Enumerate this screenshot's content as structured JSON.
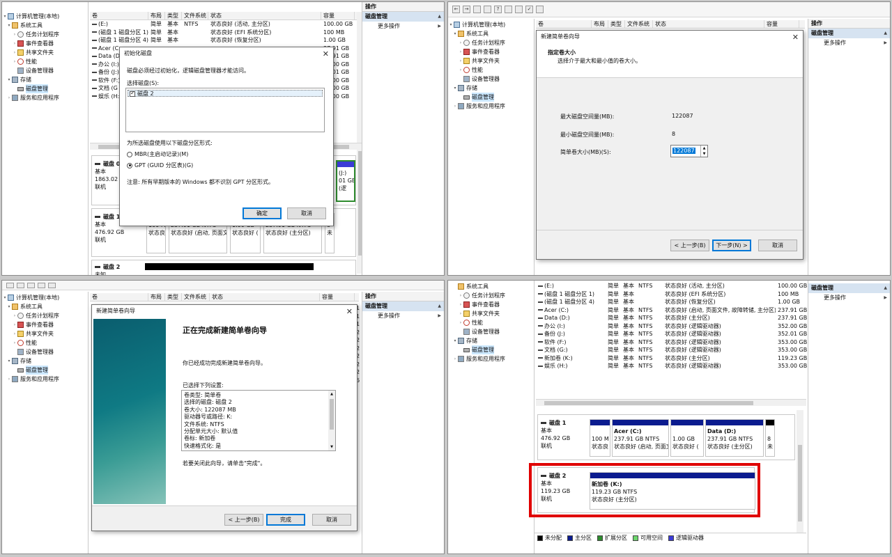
{
  "tree": {
    "root": "计算机管理(本地)",
    "system_tools": "系统工具",
    "task_scheduler": "任务计划程序",
    "event_viewer": "事件查看器",
    "shared_folders": "共享文件夹",
    "performance": "性能",
    "device_manager": "设备管理器",
    "storage": "存储",
    "disk_management": "磁盘管理",
    "services": "服务和应用程序"
  },
  "columns": {
    "volume": "卷",
    "layout": "布局",
    "type": "类型",
    "fs": "文件系统",
    "status": "状态",
    "capacity": "容量"
  },
  "actions": {
    "header": "操作",
    "section": "磁盘管理",
    "more": "更多操作"
  },
  "p1": {
    "volumes": [
      {
        "name": "(E:)",
        "layout": "简单",
        "type": "基本",
        "fs": "NTFS",
        "status": "状态良好 (活动, 主分区)",
        "cap": "100.00 GB",
        "x": "1"
      },
      {
        "name": "(磁盘 1 磁盘分区 1)",
        "layout": "简单",
        "type": "基本",
        "fs": "",
        "status": "状态良好 (EFI 系统分区)",
        "cap": "100 MB",
        "x": "1"
      },
      {
        "name": "(磁盘 1 磁盘分区 4)",
        "layout": "简单",
        "type": "基本",
        "fs": "",
        "status": "状态良好 (恢复分区)",
        "cap": "1.00 GB",
        "x": "1"
      },
      {
        "name": "Acer (C",
        "layout": "",
        "type": "",
        "fs": "",
        "status": "",
        "cap": "37.91 GB",
        "x": "2"
      },
      {
        "name": "Data (D",
        "layout": "",
        "type": "",
        "fs": "",
        "status": "",
        "cap": "37.91 GB",
        "x": "2"
      },
      {
        "name": "办公 (I:)",
        "layout": "",
        "type": "",
        "fs": "",
        "status": "",
        "cap": "52.00 GB",
        "x": "2"
      },
      {
        "name": "备份 (J:)",
        "layout": "",
        "type": "",
        "fs": "",
        "status": "",
        "cap": "52.01 GB",
        "x": "2"
      },
      {
        "name": "软件 (F:)",
        "layout": "",
        "type": "",
        "fs": "",
        "status": "",
        "cap": "53.00 GB",
        "x": "2"
      },
      {
        "name": "文档 (G",
        "layout": "",
        "type": "",
        "fs": "",
        "status": "",
        "cap": "53.00 GB",
        "x": "2"
      },
      {
        "name": "娱乐 (H:",
        "layout": "",
        "type": "",
        "fs": "",
        "status": "",
        "cap": "53.00 GB",
        "x": "6"
      }
    ],
    "disk0": {
      "name": "磁盘 0",
      "kind": "基本",
      "size": "1863.02 G",
      "state": "联机",
      "tail1": "(J:)",
      "tail2": "01 GB",
      "tail3": "(逻"
    },
    "disk1": {
      "name": "磁盘 1",
      "kind": "基本",
      "size": "476.92 GB",
      "state": "联机",
      "parts": [
        {
          "l1": "100 M",
          "l2": "状态良"
        },
        {
          "l1": "237.91 GB NTFS",
          "l2": "状态良好 (启动, 页面文"
        },
        {
          "l1": "1.00 GB",
          "l2": "状态良好 ("
        },
        {
          "l1": "237.91 GB NTFS",
          "l2": "状态良好 (主分区)"
        },
        {
          "l1": "8",
          "l2": "未"
        }
      ]
    },
    "disk2": {
      "name": "磁盘 2",
      "kind": "未知"
    },
    "dialog": {
      "title": "初始化磁盘",
      "intro": "磁盘必须经过初始化，逻辑磁盘管理器才能访问。",
      "select_label": "选择磁盘(S):",
      "disk_item": "磁盘 2",
      "style_label": "为所选磁盘使用以下磁盘分区形式:",
      "mbr": "MBR(主启动记录)(M)",
      "gpt": "GPT (GUID 分区表)(G)",
      "note": "注意: 所有早期版本的 Windows 都不识别 GPT 分区形式。",
      "ok": "确定",
      "cancel": "取消"
    }
  },
  "p2": {
    "dialog": {
      "title": "新建简单卷向导",
      "heading": "指定卷大小",
      "subheading": "选择介于最大和最小值的卷大小。",
      "max_label": "最大磁盘空间量(MB):",
      "max_value": "122087",
      "min_label": "最小磁盘空间量(MB):",
      "min_value": "8",
      "size_label": "简单卷大小(MB)(S):",
      "size_value": "122087",
      "back": "< 上一步(B)",
      "next": "下一步(N) >",
      "cancel": "取消"
    },
    "right_digits": [
      "5",
      "1",
      "1",
      "2",
      "2",
      "2",
      "2",
      "2",
      "2",
      "6"
    ]
  },
  "p3": {
    "dialog": {
      "title": "新建简单卷向导",
      "heading": "正在完成新建简单卷向导",
      "done_text": "你已经成功完成新建简单卷向导。",
      "settings_label": "已选择下列设置:",
      "settings": [
        "卷类型: 简单卷",
        "选择的磁盘: 磁盘 2",
        "卷大小: 122087 MB",
        "驱动器号或路径: K:",
        "文件系统: NTFS",
        "分配单元大小: 默认值",
        "卷标: 新加卷",
        "快速格式化: 是"
      ],
      "close_hint": "若要关闭此向导，请单击\"完成\"。",
      "back": "< 上一步(B)",
      "finish": "完成",
      "cancel": "取消"
    },
    "right_digits": [
      "1",
      "1",
      "1",
      "2",
      "2",
      "2",
      "2",
      "2",
      "2",
      "6"
    ]
  },
  "p4": {
    "volumes": [
      {
        "name": "(E:)",
        "layout": "简单",
        "type": "基本",
        "fs": "NTFS",
        "status": "状态良好 (活动, 主分区)",
        "cap": "100.00 GB",
        "x": "1"
      },
      {
        "name": "(磁盘 1 磁盘分区 1)",
        "layout": "简单",
        "type": "基本",
        "fs": "",
        "status": "状态良好 (EFI 系统分区)",
        "cap": "100 MB",
        "x": "1"
      },
      {
        "name": "(磁盘 1 磁盘分区 4)",
        "layout": "简单",
        "type": "基本",
        "fs": "",
        "status": "状态良好 (恢复分区)",
        "cap": "1.00 GB",
        "x": "1"
      },
      {
        "name": "Acer (C:)",
        "layout": "简单",
        "type": "基本",
        "fs": "NTFS",
        "status": "状态良好 (启动, 页面文件, 故障转储, 主分区)",
        "cap": "237.91 GB",
        "x": "2"
      },
      {
        "name": "Data (D:)",
        "layout": "简单",
        "type": "基本",
        "fs": "NTFS",
        "status": "状态良好 (主分区)",
        "cap": "237.91 GB",
        "x": "2"
      },
      {
        "name": "办公 (I:)",
        "layout": "简单",
        "type": "基本",
        "fs": "NTFS",
        "status": "状态良好 (逻辑驱动器)",
        "cap": "352.00 GB",
        "x": "2"
      },
      {
        "name": "备份 (J:)",
        "layout": "简单",
        "type": "基本",
        "fs": "NTFS",
        "status": "状态良好 (逻辑驱动器)",
        "cap": "352.01 GB",
        "x": "2"
      },
      {
        "name": "软件 (F:)",
        "layout": "简单",
        "type": "基本",
        "fs": "NTFS",
        "status": "状态良好 (逻辑驱动器)",
        "cap": "353.00 GB",
        "x": "2"
      },
      {
        "name": "文档 (G:)",
        "layout": "简单",
        "type": "基本",
        "fs": "NTFS",
        "status": "状态良好 (逻辑驱动器)",
        "cap": "353.00 GB",
        "x": "2"
      },
      {
        "name": "新加卷 (K:)",
        "layout": "简单",
        "type": "基本",
        "fs": "NTFS",
        "status": "状态良好 (主分区)",
        "cap": "119.23 GB",
        "x": "1"
      },
      {
        "name": "娱乐 (H:)",
        "layout": "简单",
        "type": "基本",
        "fs": "NTFS",
        "status": "状态良好 (逻辑驱动器)",
        "cap": "353.00 GB",
        "x": "6"
      }
    ],
    "disk1": {
      "name": "磁盘 1",
      "kind": "基本",
      "size": "476.92 GB",
      "state": "联机",
      "parts": [
        {
          "title": "",
          "l1": "100 M",
          "l2": "状态良"
        },
        {
          "title": "Acer (C:)",
          "l1": "237.91 GB NTFS",
          "l2": "状态良好 (启动, 页面文"
        },
        {
          "title": "",
          "l1": "1.00 GB",
          "l2": "状态良好 ("
        },
        {
          "title": "Data (D:)",
          "l1": "237.91 GB NTFS",
          "l2": "状态良好 (主分区)"
        },
        {
          "title": "",
          "l1": "8",
          "l2": "未"
        }
      ]
    },
    "disk2": {
      "name": "磁盘 2",
      "kind": "基本",
      "size": "119.23 GB",
      "state": "联机",
      "part": {
        "title": "新加卷 (K:)",
        "l1": "119.23 GB NTFS",
        "l2": "状态良好 (主分区)"
      }
    },
    "legend": [
      {
        "label": "未分配",
        "color": "#000000"
      },
      {
        "label": "主分区",
        "color": "#0b1b8f"
      },
      {
        "label": "扩展分区",
        "color": "#2e8b2e"
      },
      {
        "label": "可用空间",
        "color": "#6dd66d"
      },
      {
        "label": "逻辑驱动器",
        "color": "#3b3bd6"
      }
    ],
    "highlight_color": "#e00000"
  }
}
